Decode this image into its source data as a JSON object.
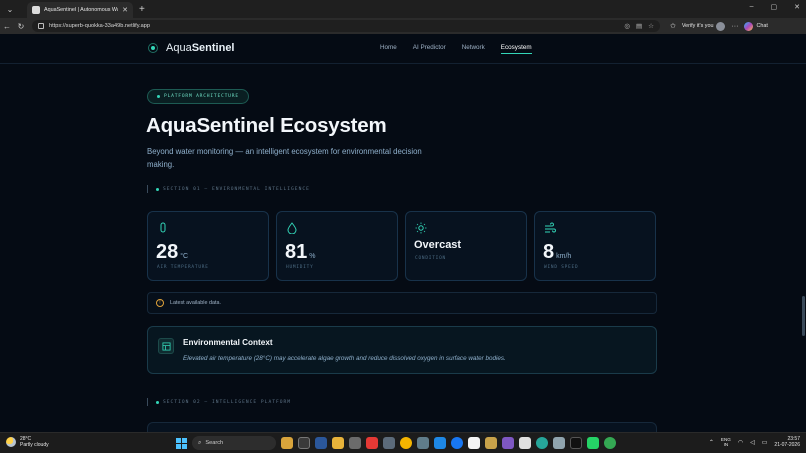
{
  "browser": {
    "tab_title": "AquaSentinel | Autonomous Wate",
    "tab_close": "✕",
    "new_tab": "+",
    "url": "https://superb-quokka-33a49b.netlify.app",
    "verify_label": "Verify it's you",
    "chat_label": "Chat",
    "menu_glyph": "⌄",
    "back_glyph": "←",
    "reload_glyph": "↻",
    "more_glyph": "···",
    "window_controls": [
      "–",
      "▢",
      "✕"
    ]
  },
  "site": {
    "brand_light": "Aqua",
    "brand_bold": "Sentinel",
    "nav": [
      {
        "label": "Home",
        "active": false
      },
      {
        "label": "AI Predictor",
        "active": false
      },
      {
        "label": "Network",
        "active": false
      },
      {
        "label": "Ecosystem",
        "active": true
      }
    ]
  },
  "hero": {
    "badge": "PLATFORM ARCHITECTURE",
    "title": "AquaSentinel Ecosystem",
    "subtitle": "Beyond water monitoring — an intelligent ecosystem for environmental decision making."
  },
  "section1": {
    "label": "SECTION 01 — ENVIRONMENTAL INTELLIGENCE"
  },
  "metrics": [
    {
      "value": "28",
      "unit": "°C",
      "label": "AIR TEMPERATURE",
      "icon": "thermometer-icon"
    },
    {
      "value": "81",
      "unit": "%",
      "label": "HUMIDITY",
      "icon": "droplet-icon"
    },
    {
      "value": "Overcast",
      "unit": "",
      "label": "CONDITION",
      "icon": "sun-icon"
    },
    {
      "value": "8",
      "unit": "km/h",
      "label": "WIND SPEED",
      "icon": "wind-icon"
    }
  ],
  "notice": {
    "text": "Latest available data.",
    "icon": "clock-icon"
  },
  "context": {
    "title": "Environmental Context",
    "body": "Elevated air temperature (28°C) may accelerate algae growth and reduce dissolved oxygen in surface water bodies."
  },
  "section2": {
    "label": "SECTION 02 — INTELLIGENCE PLATFORM"
  },
  "taskbar": {
    "weather_temp": "28°C",
    "weather_desc": "Partly cloudy",
    "search_placeholder": "Search",
    "lang_top": "ENG",
    "lang_bottom": "IN",
    "time": "23:57",
    "date": "21-07-2026"
  },
  "colors": {
    "accent": "#33d6b8",
    "background": "#050b14",
    "card_border": "#18324a",
    "warning": "#e0a23a"
  }
}
